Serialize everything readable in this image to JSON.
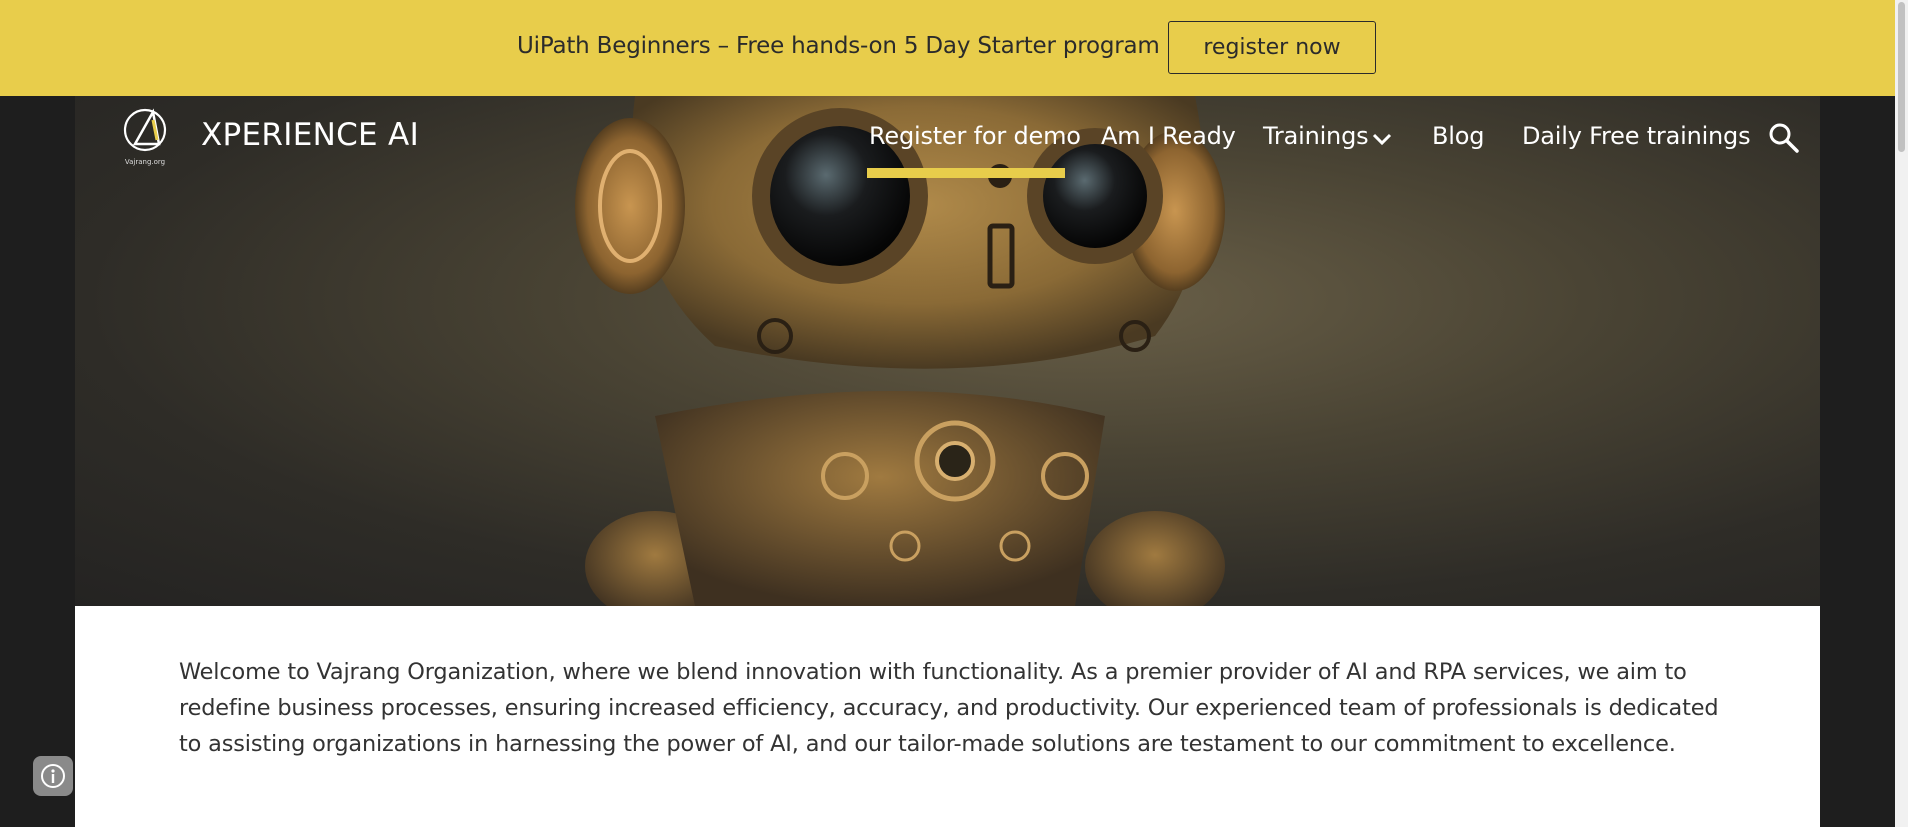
{
  "banner": {
    "text": "UiPath Beginners – Free hands-on 5 Day Starter program",
    "button_label": "register now"
  },
  "header": {
    "site_title": "XPERIENCE AI",
    "logo_caption": "Vajrang.org",
    "nav": {
      "register_demo": "Register for demo",
      "am_i_ready": "Am I Ready",
      "trainings": "Trainings",
      "blog": "Blog",
      "daily_free": "Daily Free trainings"
    },
    "active_nav": "Register for demo",
    "icons": [
      "chevron-down-icon",
      "search-icon"
    ]
  },
  "main": {
    "intro": "Welcome to Vajrang Organization, where we blend innovation with functionality. As a premier provider of AI and RPA services, we aim to redefine business processes, ensuring increased efficiency, accuracy, and productivity. Our experienced team of professionals is dedicated to assisting organizations in harnessing the power of AI, and our tailor-made solutions are testament to our commitment to excellence."
  },
  "colors": {
    "accent": "#e8cd4b",
    "banner_text": "#2b2b2b",
    "page_bg": "#1e1e1e",
    "body_text": "#333333"
  },
  "floating": {
    "icon": "info-icon"
  }
}
